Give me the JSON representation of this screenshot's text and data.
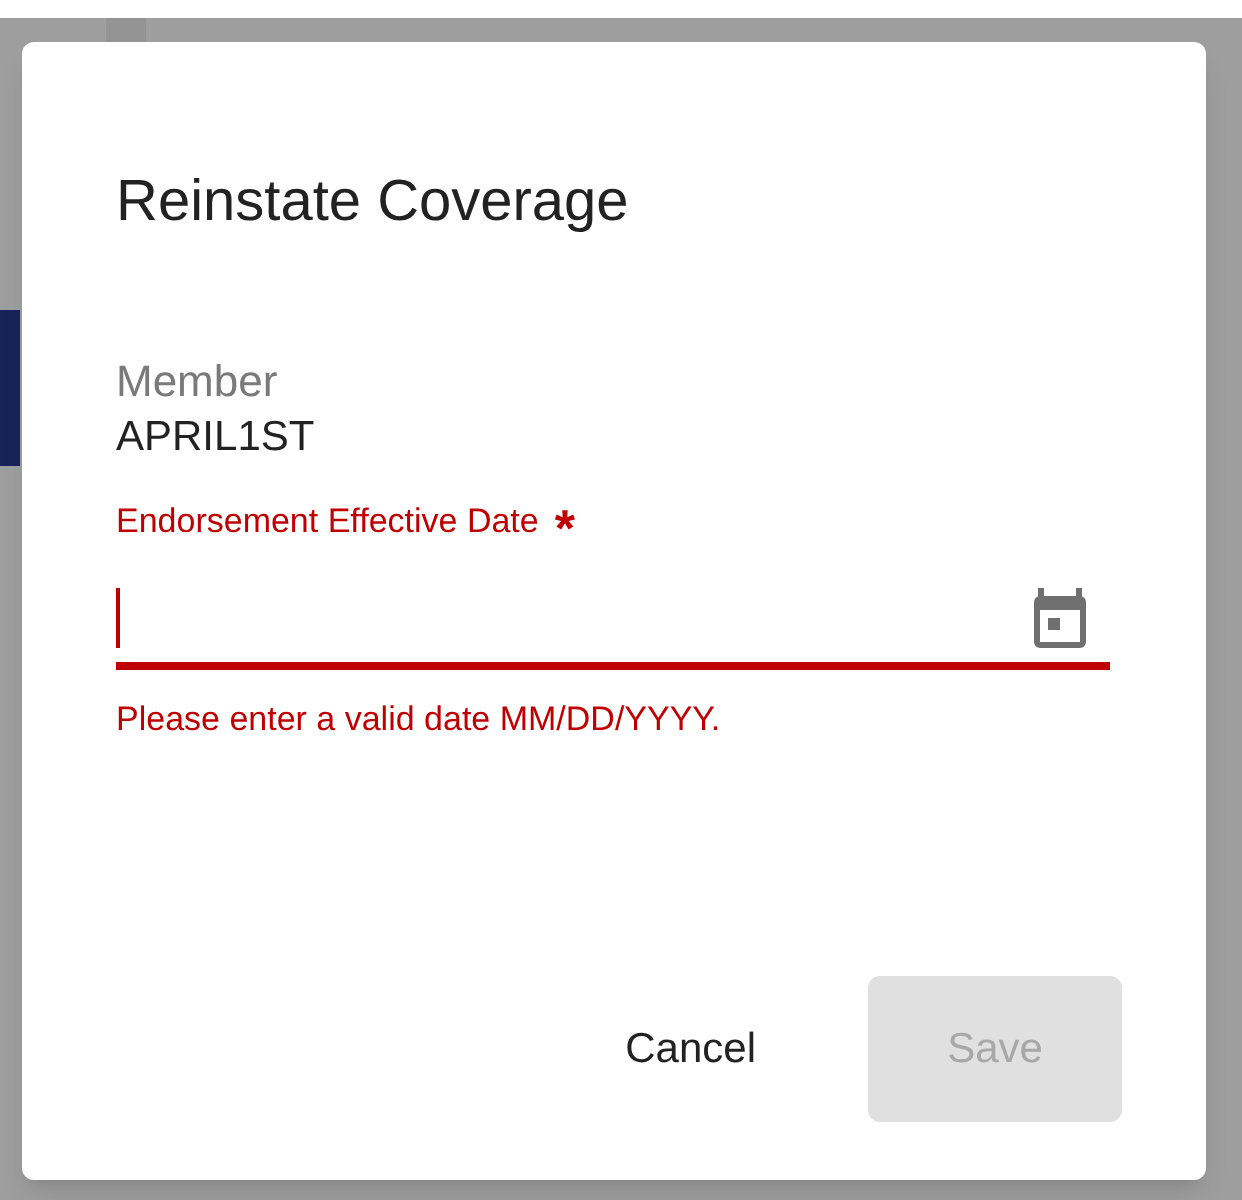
{
  "dialog": {
    "title": "Reinstate Coverage",
    "member": {
      "label": "Member",
      "value": "APRIL1ST"
    },
    "date_field": {
      "label": "Endorsement Effective Date",
      "required_mark": "*",
      "error": true,
      "focused": true,
      "error_text": "Please enter a valid date MM/DD/YYYY."
    },
    "buttons": [
      {
        "label": "Cancel",
        "kind": "text",
        "disabled": false
      },
      {
        "label": "Save",
        "kind": "contained",
        "disabled": true
      }
    ]
  }
}
